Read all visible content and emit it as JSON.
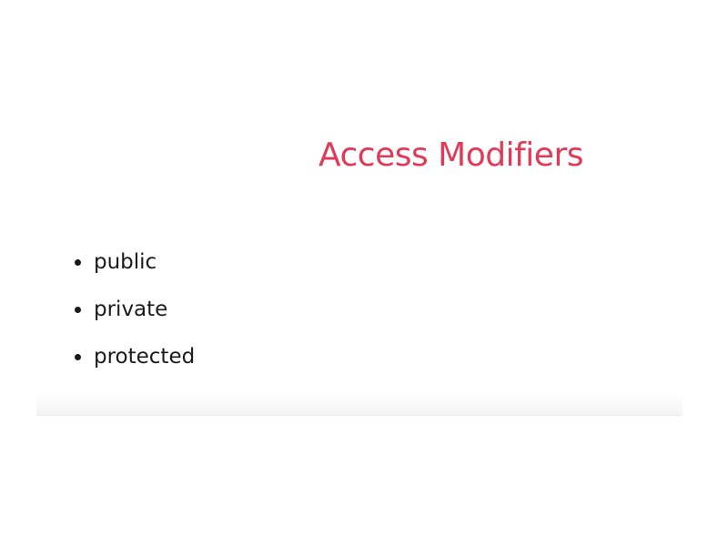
{
  "slide": {
    "title": "Access Modifiers",
    "title_color": "#e03a58",
    "bullets": [
      "public",
      "private",
      "protected"
    ]
  }
}
